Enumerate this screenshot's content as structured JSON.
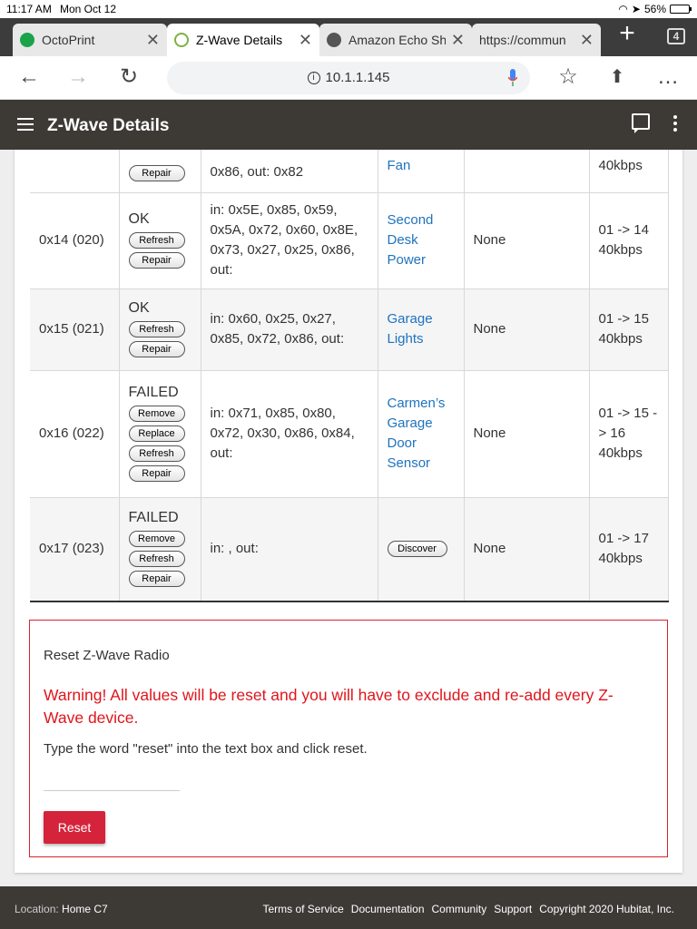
{
  "statusbar": {
    "time": "11:17 AM",
    "date": "Mon Oct 12",
    "battery": "56%"
  },
  "tabs": [
    {
      "title": "OctoPrint",
      "icon_color": "#1aa34a"
    },
    {
      "title": "Z-Wave Details",
      "icon_color": "#7cb342"
    },
    {
      "title": "Amazon Echo Sh",
      "icon_color": "#555555"
    },
    {
      "title": "https://commun"
    }
  ],
  "tab_count": "4",
  "toolbar": {
    "url": "10.1.1.145"
  },
  "appbar": {
    "title": "Z-Wave Details"
  },
  "table": {
    "rows": [
      {
        "node": "",
        "status": "",
        "buttons": [
          "Repair"
        ],
        "classes": "0x86, out: 0x82",
        "device": "Fan",
        "security": "",
        "route": "40kbps"
      },
      {
        "node": "0x14 (020)",
        "status": "OK",
        "buttons": [
          "Refresh",
          "Repair"
        ],
        "classes": "in: 0x5E, 0x85, 0x59, 0x5A, 0x72, 0x60, 0x8E, 0x73, 0x27, 0x25, 0x86, out:",
        "device": "Second Desk Power",
        "security": "None",
        "route": "01 -> 14 40kbps"
      },
      {
        "node": "0x15 (021)",
        "status": "OK",
        "buttons": [
          "Refresh",
          "Repair"
        ],
        "classes": "in: 0x60, 0x25, 0x27, 0x85, 0x72, 0x86, out:",
        "device": "Garage Lights",
        "security": "None",
        "route": "01 -> 15 40kbps"
      },
      {
        "node": "0x16 (022)",
        "status": "FAILED",
        "buttons": [
          "Remove",
          "Replace",
          "Refresh",
          "Repair"
        ],
        "classes": "in: 0x71, 0x85, 0x80, 0x72, 0x30, 0x86, 0x84, out:",
        "device": "Carmen’s Garage Door Sensor",
        "security": "None",
        "route": "01 -> 15 -> 16 40kbps"
      },
      {
        "node": "0x17 (023)",
        "status": "FAILED",
        "buttons": [
          "Remove",
          "Refresh",
          "Repair"
        ],
        "classes": "in: , out:",
        "discover_label": "Discover",
        "security": "None",
        "route": "01 -> 17 40kbps"
      }
    ]
  },
  "reset": {
    "title": "Reset Z-Wave Radio",
    "warning": "Warning! All values will be reset and you will have to exclude and re-add every Z-Wave device.",
    "instruction": "Type the word \"reset\" into the text box and click reset.",
    "input_value": "",
    "button_label": "Reset"
  },
  "footer": {
    "location_label": "Location:",
    "location_value": "Home C7",
    "links": [
      "Terms of Service",
      "Documentation",
      "Community",
      "Support"
    ],
    "copyright": "Copyright 2020 Hubitat, Inc."
  }
}
